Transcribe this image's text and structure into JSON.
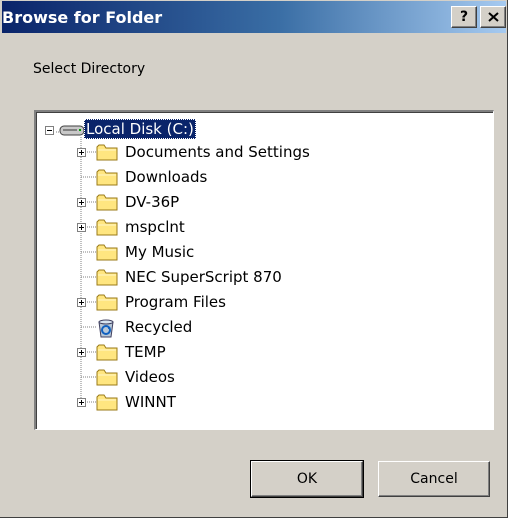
{
  "window": {
    "title": "Browse for Folder",
    "help_label": "?",
    "close_icon": "close-icon"
  },
  "instruction": "Select Directory",
  "tree": {
    "root": {
      "label": "Local Disk (C:)",
      "icon": "drive-icon",
      "expanded": true,
      "selected": true
    },
    "items": [
      {
        "label": "Documents and Settings",
        "icon": "folder-icon",
        "expandable": true
      },
      {
        "label": "Downloads",
        "icon": "folder-icon",
        "expandable": false
      },
      {
        "label": "DV-36P",
        "icon": "folder-icon",
        "expandable": true
      },
      {
        "label": "mspclnt",
        "icon": "folder-icon",
        "expandable": true
      },
      {
        "label": "My Music",
        "icon": "folder-icon",
        "expandable": false
      },
      {
        "label": "NEC SuperScript 870",
        "icon": "folder-icon",
        "expandable": false
      },
      {
        "label": "Program Files",
        "icon": "folder-icon",
        "expandable": true
      },
      {
        "label": "Recycled",
        "icon": "recycle-bin-icon",
        "expandable": false
      },
      {
        "label": "TEMP",
        "icon": "folder-icon",
        "expandable": true
      },
      {
        "label": "Videos",
        "icon": "folder-icon",
        "expandable": false
      },
      {
        "label": "WINNT",
        "icon": "folder-icon",
        "expandable": true
      }
    ]
  },
  "buttons": {
    "ok": "OK",
    "cancel": "Cancel"
  },
  "colors": {
    "title_start": "#0a246a",
    "title_end": "#a6caf0",
    "selection": "#0a246a",
    "folder": "#ffe680"
  }
}
